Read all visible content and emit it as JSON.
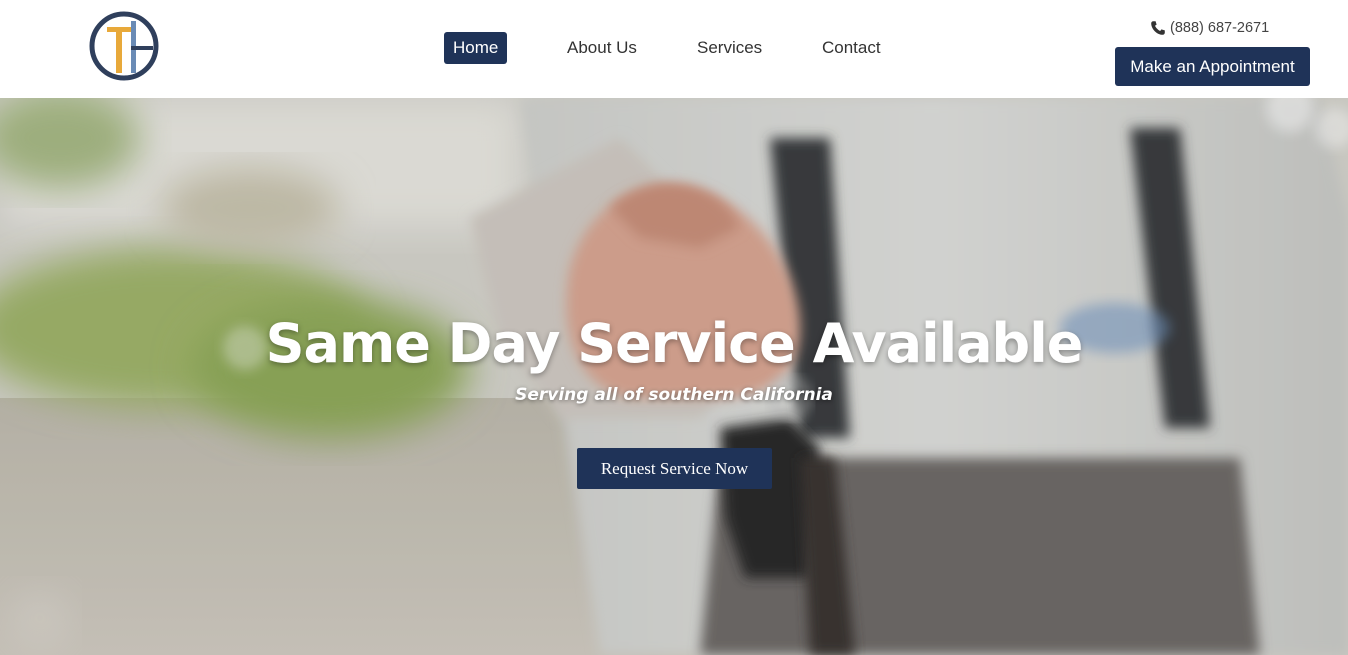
{
  "header": {
    "logo_letters": "TH",
    "nav": [
      {
        "label": "Home",
        "active": true
      },
      {
        "label": "About Us",
        "active": false
      },
      {
        "label": "Services",
        "active": false
      },
      {
        "label": "Contact",
        "active": false
      }
    ],
    "phone_icon": "phone-icon",
    "phone": "(888) 687-2671",
    "appointment_button": "Make an Appointment"
  },
  "hero": {
    "title": "Same Day Service Available",
    "subtitle": "Serving all of southern California",
    "cta_button": "Request Service Now"
  },
  "colors": {
    "brand_navy": "#1f3358",
    "logo_gold": "#e8a93a",
    "logo_blue": "#6a8bb5",
    "text_dark": "#333333"
  }
}
